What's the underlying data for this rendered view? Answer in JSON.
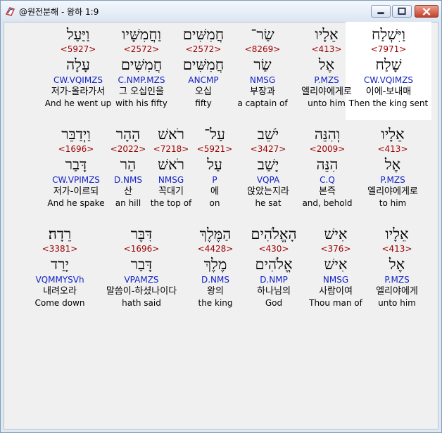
{
  "window": {
    "title": "@원전분해 - 왕하 1:9"
  },
  "colors": {
    "strongs": "#9b0000",
    "morph": "#1020c8",
    "highlight": "#ffffff"
  },
  "icons": [
    "app-icon",
    "minimize-icon",
    "maximize-icon",
    "close-icon"
  ],
  "rows": [
    [
      {
        "heb": "וַיִּשְׁלַח",
        "strongs": "<7971>",
        "lemma": "שָׁלַח",
        "morph": "CW.VQIMZS",
        "kor": "이에-보내매",
        "eng": "Then the king sent"
      },
      {
        "heb": "אֵלָיו",
        "strongs": "<413>",
        "lemma": "אֶל",
        "morph": "P.MZS",
        "kor": "엘리야에게로",
        "eng": "unto him"
      },
      {
        "heb": "שַׂר־",
        "strongs": "<8269>",
        "lemma": "שַׂר",
        "morph": "NMSG",
        "kor": "부장과",
        "eng": "a captain of"
      },
      {
        "heb": "חֲמִשִּׁים",
        "strongs": "<2572>",
        "lemma": "חֲמִשִּׁים",
        "morph": "ANCMP",
        "kor": "오십",
        "eng": "fifty"
      },
      {
        "heb": "וַחֲמִשָּׁיו",
        "strongs": "<2572>",
        "lemma": "חֲמִשִּׁים",
        "morph": "C.NMP.MZS",
        "kor": "그 오십인을",
        "eng": "with his fifty"
      },
      {
        "heb": "וַיַּעַל",
        "strongs": "<5927>",
        "lemma": "עָלָה",
        "morph": "CW.VQIMZS",
        "kor": "저가-올라가서",
        "eng": "And he went up"
      }
    ],
    [
      {
        "heb": "אֵלָיו",
        "strongs": "<413>",
        "lemma": "אֶל",
        "morph": "P.MZS",
        "kor": "엘리야에게로",
        "eng": "to him"
      },
      {
        "heb": "וְהִנֵּה",
        "strongs": "<2009>",
        "lemma": "הִנֵּה",
        "morph": "C.Q",
        "kor": "본즉",
        "eng": "and, behold"
      },
      {
        "heb": "יֹשֵׁב",
        "strongs": "<3427>",
        "lemma": "יָשַׁב",
        "morph": "VQPA",
        "kor": "앉았는지라",
        "eng": "he sat"
      },
      {
        "heb": "עַל־",
        "strongs": "<5921>",
        "lemma": "עַל",
        "morph": "P",
        "kor": "에",
        "eng": "on"
      },
      {
        "heb": "רֹאשׁ",
        "strongs": "<7218>",
        "lemma": "רֹאשׁ",
        "morph": "NMSG",
        "kor": "꼭대기",
        "eng": "the top of"
      },
      {
        "heb": "הָהָר",
        "strongs": "<2022>",
        "lemma": "הַר",
        "morph": "D.NMS",
        "kor": "산",
        "eng": "an hill"
      },
      {
        "heb": "וַיְדַבֵּר",
        "strongs": "<1696>",
        "lemma": "דָּבַר",
        "morph": "CW.VPIMZS",
        "kor": "저가-이르되",
        "eng": "And he spake"
      }
    ],
    [
      {
        "heb": "אֵלָיו",
        "strongs": "<413>",
        "lemma": "אֶל",
        "morph": "P.MZS",
        "kor": "엘리야에게",
        "eng": "unto him"
      },
      {
        "heb": "אִישׁ",
        "strongs": "<376>",
        "lemma": "אִישׁ",
        "morph": "NMSG",
        "kor": "사람이여",
        "eng": "Thou man of"
      },
      {
        "heb": "הָאֱלֹהִים",
        "strongs": "<430>",
        "lemma": "אֱלֹהִים",
        "morph": "D.NMP",
        "kor": "하나님의",
        "eng": "God"
      },
      {
        "heb": "הַמֶּלֶךְ",
        "strongs": "<4428>",
        "lemma": "מֶלֶךְ",
        "morph": "D.NMS",
        "kor": "왕의",
        "eng": "the king"
      },
      {
        "heb": "דִּבֶּר",
        "strongs": "<1696>",
        "lemma": "דָּבַר",
        "morph": "VPAMZS",
        "kor": "말씀이-하셨나이다",
        "eng": "hath said"
      },
      {
        "heb": "רֵדָה׃",
        "strongs": "<3381>",
        "lemma": "יָרַד",
        "morph": "VQMMYSVh",
        "kor": "내려오라",
        "eng": "Come down"
      }
    ]
  ]
}
